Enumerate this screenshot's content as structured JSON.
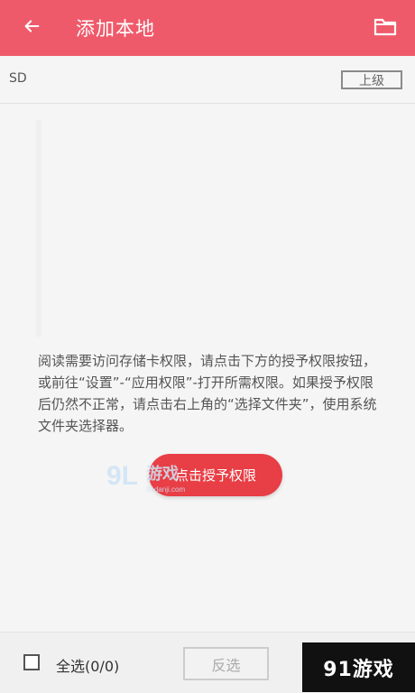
{
  "appbar": {
    "title": "添加本地"
  },
  "path": {
    "current": "SD",
    "up_label": "上级"
  },
  "content": {
    "message": "阅读需要访问存储卡权限，请点击下方的授予权限按钮，或前往“设置”-“应用权限”-打开所需权限。如果授予权限后仍然不正常，请点击右上角的“选择文件夹”，使用系统文件夹选择器。",
    "grant_button": "点击授予权限",
    "watermark_logo_text": "91游戏",
    "watermark_site": "91danji.com"
  },
  "bottom": {
    "select_all": "全选(0/0)",
    "invert": "反选",
    "brand_watermark": "91游戏"
  },
  "colors": {
    "accent": "#ef5a6b",
    "button": "#e83e45"
  },
  "icons": [
    "back-arrow-icon",
    "folder-icon",
    "checkbox-icon"
  ]
}
